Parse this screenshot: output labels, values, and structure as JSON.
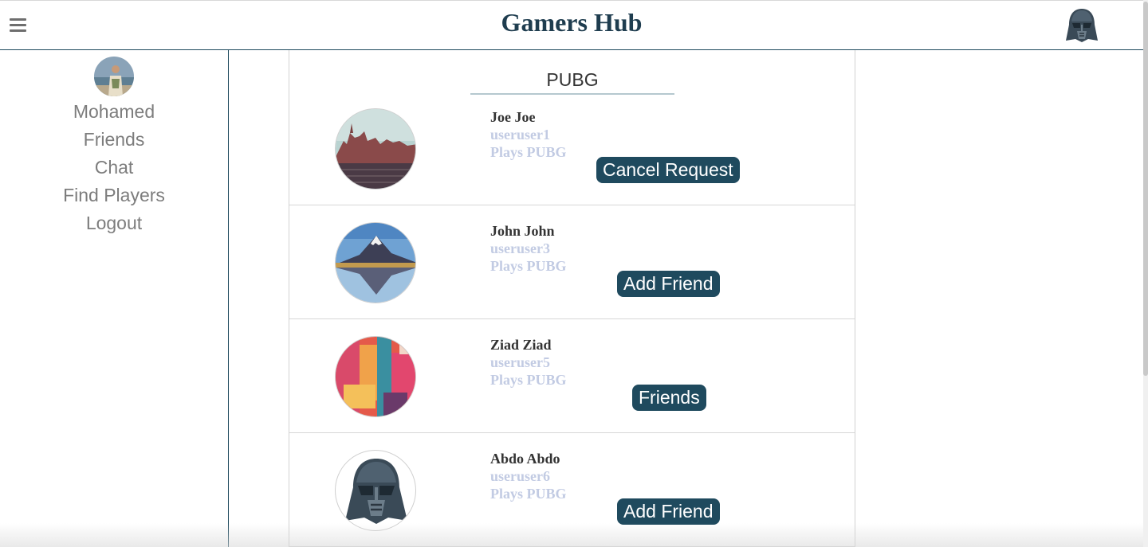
{
  "header": {
    "title": "Gamers Hub"
  },
  "sidebar": {
    "username": "Mohamed",
    "links": [
      "Friends",
      "Chat",
      "Find Players",
      "Logout"
    ]
  },
  "feed": {
    "game": "PUBG",
    "players": [
      {
        "name": "Joe Joe",
        "username": "useruser1",
        "plays": "Plays PUBG",
        "action": "Cancel Request",
        "avatar": "castle-photo"
      },
      {
        "name": "John John",
        "username": "useruser3",
        "plays": "Plays PUBG",
        "action": "Add Friend",
        "avatar": "mountain-photo"
      },
      {
        "name": "Ziad Ziad",
        "username": "useruser5",
        "plays": "Plays PUBG",
        "action": "Friends",
        "avatar": "abstract-painting"
      },
      {
        "name": "Abdo Abdo",
        "username": "useruser6",
        "plays": "Plays PUBG",
        "action": "Add Friend",
        "avatar": "darth-vader-icon"
      }
    ]
  },
  "colors": {
    "accent": "#1f4a5e",
    "muted_text": "#c2cbe3",
    "sidebar_text": "#7d7d7d"
  }
}
